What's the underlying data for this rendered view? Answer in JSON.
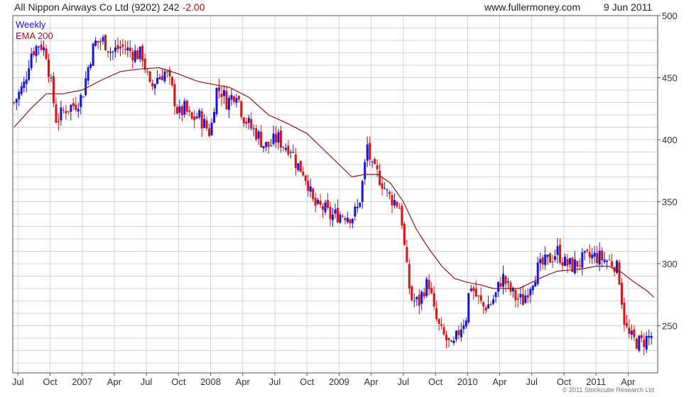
{
  "header": {
    "title": "All Nippon Airways Co Ltd (9202) 242",
    "change": "-2.00",
    "website": "www.fullermoney.com",
    "date": "9 Jun 2011"
  },
  "footer": {
    "copyright": "© 2011 Stockcube Research Ltd"
  },
  "colors": {
    "up": "#1515dd",
    "down": "#dd1111",
    "ema": "#8b1a1a",
    "grid": "#d4d4d4",
    "frame": "#555555"
  },
  "chart_data": {
    "type": "candlestick",
    "frequency": "Weekly",
    "ylim": [
      212,
      500
    ],
    "xlim": [
      2006.46,
      2011.48
    ],
    "y_ticks": [
      250,
      300,
      350,
      400,
      450,
      500
    ],
    "x_ticks": [
      {
        "label": "Jul",
        "x": 2006.5
      },
      {
        "label": "Oct",
        "x": 2006.75
      },
      {
        "label": "2007",
        "x": 2007.0
      },
      {
        "label": "Apr",
        "x": 2007.25
      },
      {
        "label": "Jul",
        "x": 2007.5
      },
      {
        "label": "Oct",
        "x": 2007.75
      },
      {
        "label": "2008",
        "x": 2008.0
      },
      {
        "label": "Apr",
        "x": 2008.25
      },
      {
        "label": "Jul",
        "x": 2008.5
      },
      {
        "label": "Oct",
        "x": 2008.75
      },
      {
        "label": "2009",
        "x": 2009.0
      },
      {
        "label": "Apr",
        "x": 2009.25
      },
      {
        "label": "Jul",
        "x": 2009.5
      },
      {
        "label": "Oct",
        "x": 2009.75
      },
      {
        "label": "2010",
        "x": 2010.0
      },
      {
        "label": "Apr",
        "x": 2010.25
      },
      {
        "label": "Jul",
        "x": 2010.5
      },
      {
        "label": "Oct",
        "x": 2010.75
      },
      {
        "label": "2011",
        "x": 2011.0
      },
      {
        "label": "Apr",
        "x": 2011.25
      }
    ],
    "price_path": [
      [
        2006.47,
        430
      ],
      [
        2006.55,
        445
      ],
      [
        2006.6,
        470
      ],
      [
        2006.67,
        478
      ],
      [
        2006.72,
        470
      ],
      [
        2006.8,
        415
      ],
      [
        2006.87,
        425
      ],
      [
        2006.94,
        428
      ],
      [
        2007.0,
        435
      ],
      [
        2007.06,
        465
      ],
      [
        2007.1,
        478
      ],
      [
        2007.17,
        480
      ],
      [
        2007.23,
        470
      ],
      [
        2007.3,
        475
      ],
      [
        2007.4,
        470
      ],
      [
        2007.47,
        468
      ],
      [
        2007.53,
        440
      ],
      [
        2007.58,
        450
      ],
      [
        2007.65,
        455
      ],
      [
        2007.7,
        440
      ],
      [
        2007.75,
        420
      ],
      [
        2007.8,
        425
      ],
      [
        2007.85,
        415
      ],
      [
        2007.9,
        420
      ],
      [
        2008.0,
        405
      ],
      [
        2008.04,
        440
      ],
      [
        2008.08,
        440
      ],
      [
        2008.13,
        430
      ],
      [
        2008.2,
        440
      ],
      [
        2008.25,
        420
      ],
      [
        2008.31,
        410
      ],
      [
        2008.36,
        405
      ],
      [
        2008.42,
        395
      ],
      [
        2008.46,
        395
      ],
      [
        2008.52,
        402
      ],
      [
        2008.57,
        395
      ],
      [
        2008.62,
        395
      ],
      [
        2008.67,
        380
      ],
      [
        2008.72,
        375
      ],
      [
        2008.76,
        365
      ],
      [
        2008.79,
        350
      ],
      [
        2008.83,
        345
      ],
      [
        2008.88,
        345
      ],
      [
        2008.93,
        338
      ],
      [
        2009.0,
        340
      ],
      [
        2009.05,
        340
      ],
      [
        2009.1,
        338
      ],
      [
        2009.15,
        345
      ],
      [
        2009.19,
        370
      ],
      [
        2009.22,
        395
      ],
      [
        2009.26,
        375
      ],
      [
        2009.3,
        372
      ],
      [
        2009.34,
        365
      ],
      [
        2009.38,
        355
      ],
      [
        2009.44,
        350
      ],
      [
        2009.48,
        345
      ],
      [
        2009.52,
        300
      ],
      [
        2009.56,
        272
      ],
      [
        2009.62,
        268
      ],
      [
        2009.66,
        280
      ],
      [
        2009.7,
        285
      ],
      [
        2009.74,
        260
      ],
      [
        2009.79,
        245
      ],
      [
        2009.84,
        238
      ],
      [
        2009.88,
        230
      ],
      [
        2009.94,
        248
      ],
      [
        2009.99,
        258
      ],
      [
        2010.02,
        285
      ],
      [
        2010.06,
        275
      ],
      [
        2010.12,
        265
      ],
      [
        2010.18,
        268
      ],
      [
        2010.22,
        275
      ],
      [
        2010.27,
        290
      ],
      [
        2010.32,
        280
      ],
      [
        2010.38,
        272
      ],
      [
        2010.43,
        270
      ],
      [
        2010.48,
        282
      ],
      [
        2010.54,
        295
      ],
      [
        2010.6,
        300
      ],
      [
        2010.65,
        305
      ],
      [
        2010.7,
        310
      ],
      [
        2010.76,
        300
      ],
      [
        2010.82,
        298
      ],
      [
        2010.88,
        302
      ],
      [
        2010.94,
        305
      ],
      [
        2011.0,
        306
      ],
      [
        2011.05,
        304
      ],
      [
        2011.1,
        302
      ],
      [
        2011.15,
        300
      ],
      [
        2011.18,
        290
      ],
      [
        2011.2,
        272
      ],
      [
        2011.22,
        255
      ],
      [
        2011.25,
        242
      ],
      [
        2011.3,
        238
      ],
      [
        2011.35,
        236
      ],
      [
        2011.4,
        240
      ],
      [
        2011.43,
        242
      ]
    ],
    "ema": {
      "name": "EMA 200",
      "points": [
        [
          2006.47,
          410
        ],
        [
          2006.6,
          425
        ],
        [
          2006.72,
          437
        ],
        [
          2006.85,
          437
        ],
        [
          2007.0,
          440
        ],
        [
          2007.15,
          448
        ],
        [
          2007.3,
          455
        ],
        [
          2007.45,
          457
        ],
        [
          2007.6,
          458
        ],
        [
          2007.75,
          453
        ],
        [
          2007.9,
          447
        ],
        [
          2008.0,
          445
        ],
        [
          2008.15,
          442
        ],
        [
          2008.3,
          434
        ],
        [
          2008.45,
          420
        ],
        [
          2008.6,
          413
        ],
        [
          2008.75,
          405
        ],
        [
          2008.9,
          390
        ],
        [
          2009.0,
          380
        ],
        [
          2009.1,
          370
        ],
        [
          2009.2,
          372
        ],
        [
          2009.3,
          372
        ],
        [
          2009.4,
          365
        ],
        [
          2009.5,
          350
        ],
        [
          2009.6,
          328
        ],
        [
          2009.7,
          312
        ],
        [
          2009.8,
          298
        ],
        [
          2009.9,
          288
        ],
        [
          2010.0,
          285
        ],
        [
          2010.1,
          283
        ],
        [
          2010.2,
          280
        ],
        [
          2010.3,
          280
        ],
        [
          2010.4,
          280
        ],
        [
          2010.5,
          285
        ],
        [
          2010.6,
          290
        ],
        [
          2010.7,
          294
        ],
        [
          2010.8,
          295
        ],
        [
          2010.9,
          296
        ],
        [
          2011.0,
          298
        ],
        [
          2011.1,
          298
        ],
        [
          2011.2,
          293
        ],
        [
          2011.3,
          285
        ],
        [
          2011.4,
          278
        ],
        [
          2011.45,
          273
        ]
      ]
    }
  }
}
